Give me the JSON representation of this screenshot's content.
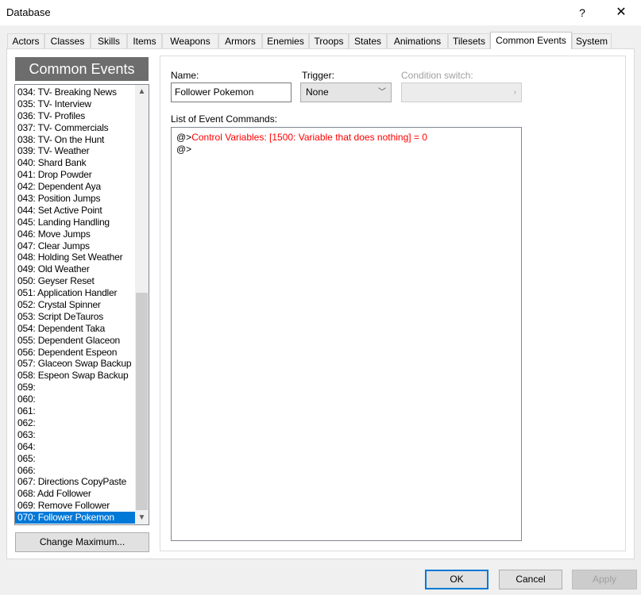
{
  "window": {
    "title": "Database",
    "help_button": "?",
    "close_button": "✕"
  },
  "tabs": [
    {
      "label": "Actors"
    },
    {
      "label": "Classes"
    },
    {
      "label": "Skills"
    },
    {
      "label": "Items"
    },
    {
      "label": "Weapons"
    },
    {
      "label": "Armors"
    },
    {
      "label": "Enemies"
    },
    {
      "label": "Troops"
    },
    {
      "label": "States"
    },
    {
      "label": "Animations"
    },
    {
      "label": "Tilesets"
    },
    {
      "label": "Common Events"
    },
    {
      "label": "System"
    }
  ],
  "active_tab": "Common Events",
  "left_panel": {
    "header": "Common Events",
    "items": [
      "034: TV- Breaking News",
      "035: TV- Interview",
      "036: TV- Profiles",
      "037: TV- Commercials",
      "038: TV- On the Hunt",
      "039: TV- Weather",
      "040: Shard Bank",
      "041: Drop Powder",
      "042: Dependent Aya",
      "043: Position Jumps",
      "044: Set Active Point",
      "045: Landing Handling",
      "046: Move Jumps",
      "047: Clear Jumps",
      "048: Holding Set Weather",
      "049: Old Weather",
      "050: Geyser Reset",
      "051: Application Handler",
      "052: Crystal Spinner",
      "053: Script DeTauros",
      "054: Dependent Taka",
      "055: Dependent Glaceon",
      "056: Dependent Espeon",
      "057: Glaceon Swap Backup",
      "058: Espeon Swap Backup",
      "059:",
      "060:",
      "061:",
      "062:",
      "063:",
      "064:",
      "065:",
      "066:",
      "067: Directions CopyPaste",
      "068: Add Follower",
      "069: Remove Follower",
      "070: Follower Pokemon"
    ],
    "selected_item": "070: Follower Pokemon",
    "change_max_button": "Change Maximum..."
  },
  "right_panel": {
    "name_label": "Name:",
    "name_value": "Follower Pokemon",
    "trigger_label": "Trigger:",
    "trigger_value": "None",
    "condition_label": "Condition switch:",
    "condition_value": "",
    "commands_label": "List of Event Commands:",
    "commands": [
      {
        "prefix": "@>",
        "text": "Control Variables: [1500: Variable that does nothing] = 0"
      },
      {
        "prefix": "@>",
        "text": ""
      }
    ]
  },
  "footer": {
    "ok": "OK",
    "cancel": "Cancel",
    "apply": "Apply"
  },
  "colors": {
    "selection": "#0078d7",
    "header_bg": "#6d6d6d",
    "command_red": "#ff0000"
  }
}
